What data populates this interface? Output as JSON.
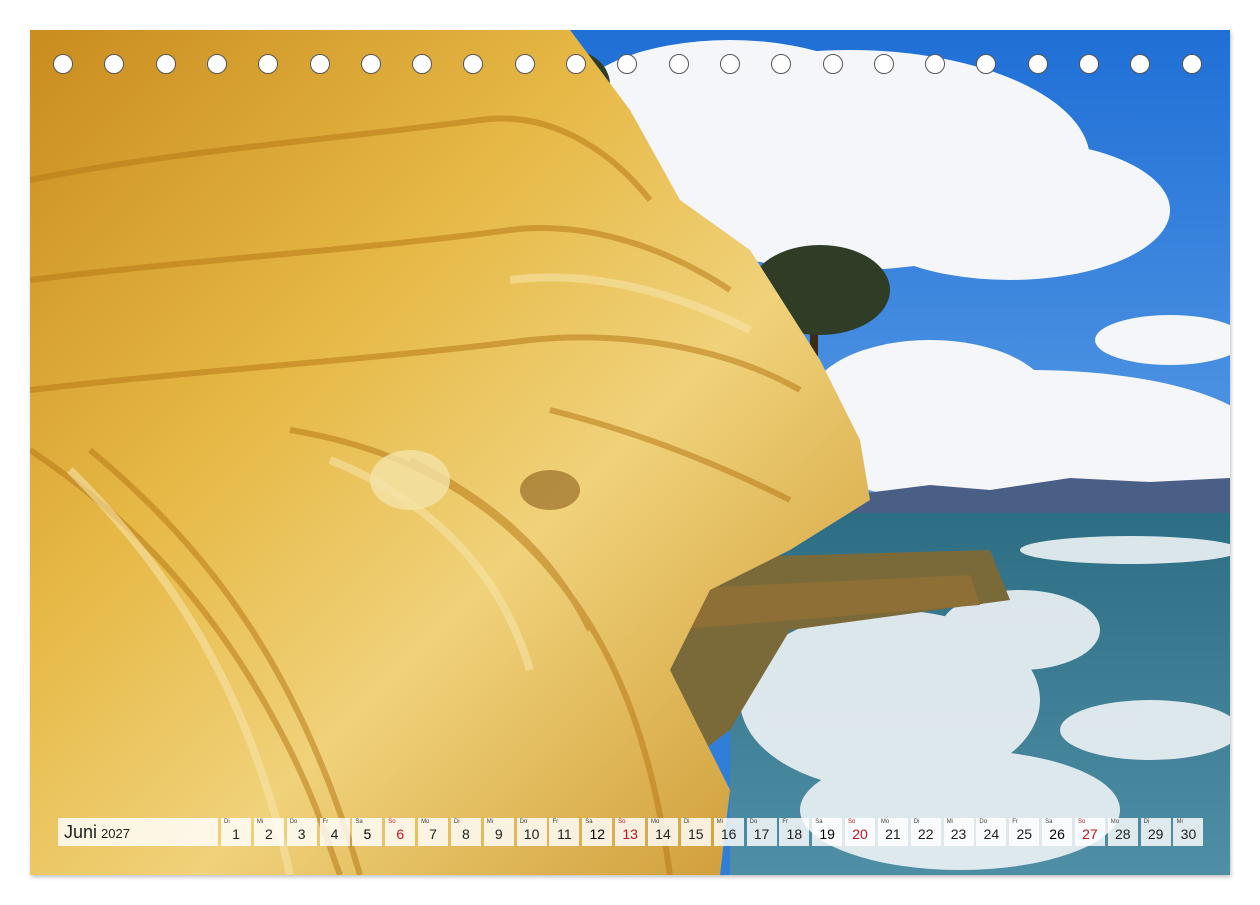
{
  "calendar": {
    "month": "Juni",
    "year": "2027",
    "days": [
      {
        "wd": "Di",
        "num": "1",
        "kind": "weekday"
      },
      {
        "wd": "Mi",
        "num": "2",
        "kind": "weekday"
      },
      {
        "wd": "Do",
        "num": "3",
        "kind": "weekday"
      },
      {
        "wd": "Fr",
        "num": "4",
        "kind": "weekday"
      },
      {
        "wd": "Sa",
        "num": "5",
        "kind": "sat"
      },
      {
        "wd": "So",
        "num": "6",
        "kind": "sun"
      },
      {
        "wd": "Mo",
        "num": "7",
        "kind": "weekday"
      },
      {
        "wd": "Di",
        "num": "8",
        "kind": "weekday"
      },
      {
        "wd": "Mi",
        "num": "9",
        "kind": "weekday"
      },
      {
        "wd": "Do",
        "num": "10",
        "kind": "weekday"
      },
      {
        "wd": "Fr",
        "num": "11",
        "kind": "weekday"
      },
      {
        "wd": "Sa",
        "num": "12",
        "kind": "sat"
      },
      {
        "wd": "So",
        "num": "13",
        "kind": "sun"
      },
      {
        "wd": "Mo",
        "num": "14",
        "kind": "weekday"
      },
      {
        "wd": "Di",
        "num": "15",
        "kind": "weekday"
      },
      {
        "wd": "Mi",
        "num": "16",
        "kind": "weekday"
      },
      {
        "wd": "Do",
        "num": "17",
        "kind": "weekday"
      },
      {
        "wd": "Fr",
        "num": "18",
        "kind": "weekday"
      },
      {
        "wd": "Sa",
        "num": "19",
        "kind": "sat"
      },
      {
        "wd": "So",
        "num": "20",
        "kind": "sun"
      },
      {
        "wd": "Mo",
        "num": "21",
        "kind": "weekday"
      },
      {
        "wd": "Di",
        "num": "22",
        "kind": "weekday"
      },
      {
        "wd": "Mi",
        "num": "23",
        "kind": "weekday"
      },
      {
        "wd": "Do",
        "num": "24",
        "kind": "weekday"
      },
      {
        "wd": "Fr",
        "num": "25",
        "kind": "weekday"
      },
      {
        "wd": "Sa",
        "num": "26",
        "kind": "sat"
      },
      {
        "wd": "So",
        "num": "27",
        "kind": "sun"
      },
      {
        "wd": "Mo",
        "num": "28",
        "kind": "weekday"
      },
      {
        "wd": "Di",
        "num": "29",
        "kind": "weekday"
      },
      {
        "wd": "Mi",
        "num": "30",
        "kind": "weekday"
      }
    ]
  },
  "binding_holes": 23,
  "colors": {
    "sunday": "#c0141c",
    "sky": "#2f7fd8",
    "sandstone": "#e0b03c",
    "sea": "#3f7f8c"
  }
}
